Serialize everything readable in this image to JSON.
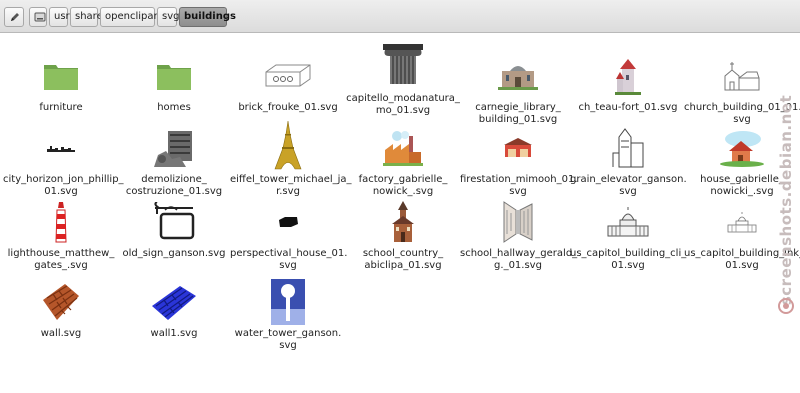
{
  "toolbar": {
    "edit_icon": "pencil-icon",
    "root_icon": "drive-icon",
    "crumbs": [
      "usr",
      "share",
      "openclipart",
      "svg"
    ],
    "active_crumb": "buildings"
  },
  "items": [
    {
      "label": "furniture",
      "icon": "folder-icon"
    },
    {
      "label": "homes",
      "icon": "folder-icon"
    },
    {
      "label": "brick_frouke_01.svg",
      "icon": "brick-sketch-icon"
    },
    {
      "label": "capitello_modanatura_\nmo_01.svg",
      "icon": "column-capital-icon"
    },
    {
      "label": "carnegie_library_\nbuilding_01.svg",
      "icon": "library-icon"
    },
    {
      "label": "ch_teau-fort_01.svg",
      "icon": "castle-icon"
    },
    {
      "label": "church_building_01_01.\nsvg",
      "icon": "church-icon"
    },
    {
      "label": "city_horizon_jon_phillip_\n01.svg",
      "icon": "skyline-icon"
    },
    {
      "label": "demolizione_\ncostruzione_01.svg",
      "icon": "demolition-icon"
    },
    {
      "label": "eiffel_tower_michael_ja_\nr.svg",
      "icon": "eiffel-tower-icon"
    },
    {
      "label": "factory_gabrielle_\nnowick_.svg",
      "icon": "factory-icon"
    },
    {
      "label": "firestation_mimooh_01.\nsvg",
      "icon": "firestation-icon"
    },
    {
      "label": "grain_elevator_ganson.\nsvg",
      "icon": "grain-elevator-icon"
    },
    {
      "label": "house_gabrielle_\nnowicki_.svg",
      "icon": "house-icon"
    },
    {
      "label": "lighthouse_matthew_\ngates_.svg",
      "icon": "lighthouse-icon"
    },
    {
      "label": "old_sign_ganson.svg",
      "icon": "old-sign-icon"
    },
    {
      "label": "perspectival_house_01.\nsvg",
      "icon": "perspective-house-icon"
    },
    {
      "label": "school_country_\nabiclipa_01.svg",
      "icon": "school-icon"
    },
    {
      "label": "school_hallway_gerald_\ng._01.svg",
      "icon": "hallway-icon"
    },
    {
      "label": "us_capitol_building_cli_\n01.svg",
      "icon": "capitol-icon"
    },
    {
      "label": "us_capitol_building_ink_\n01.svg",
      "icon": "capitol-ink-icon"
    },
    {
      "label": "wall.svg",
      "icon": "brick-wall-icon"
    },
    {
      "label": "wall1.svg",
      "icon": "blue-wall-icon"
    },
    {
      "label": "water_tower_ganson.\nsvg",
      "icon": "water-tower-icon"
    }
  ],
  "watermark": "screenshots.debian.net"
}
